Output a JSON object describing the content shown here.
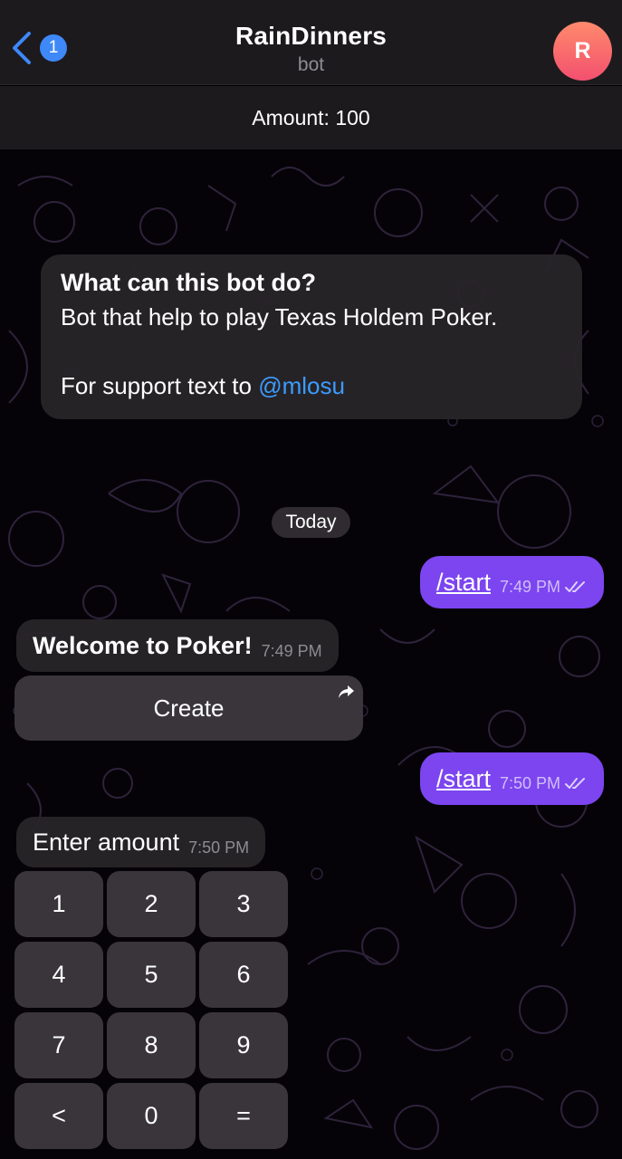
{
  "header": {
    "back_badge": "1",
    "title": "RainDinners",
    "subtitle": "bot",
    "avatar_letter": "R"
  },
  "pinned": {
    "text": "Amount: 100"
  },
  "intro": {
    "title": "What can this bot do?",
    "description": "Bot that help to play Texas Holdem Poker.",
    "support_prefix": "For support text to ",
    "support_mention": "@mlosu"
  },
  "date_separator": "Today",
  "messages": [
    {
      "type": "out",
      "text": "/start",
      "time": "7:49 PM"
    },
    {
      "type": "in",
      "text": "Welcome to Poker!",
      "time": "7:49 PM"
    },
    {
      "type": "out",
      "text": "/start",
      "time": "7:50 PM"
    },
    {
      "type": "in",
      "text": "Enter amount",
      "time": "7:50 PM"
    }
  ],
  "inline_button": {
    "label": "Create"
  },
  "keypad": [
    {
      "label": "1"
    },
    {
      "label": "2"
    },
    {
      "label": "3"
    },
    {
      "label": "4"
    },
    {
      "label": "5"
    },
    {
      "label": "6"
    },
    {
      "label": "7"
    },
    {
      "label": "8"
    },
    {
      "label": "9"
    },
    {
      "label": "<"
    },
    {
      "label": "0"
    },
    {
      "label": "="
    }
  ],
  "colors": {
    "accent": "#3e88f7",
    "outgoing_bubble": "#7c45f0",
    "mention": "#3b9cff",
    "avatar_gradient": [
      "#ff8a6c",
      "#f2506e"
    ]
  },
  "icons": {
    "back": "chevron-left-icon",
    "read_status": "double-check-icon",
    "share": "share-arrow-icon"
  }
}
